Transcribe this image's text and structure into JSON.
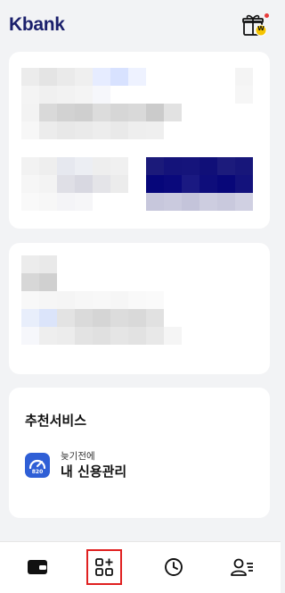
{
  "header": {
    "logo_text": "Kbank",
    "gift_icon": "gift-icon",
    "gift_badge_text": "W"
  },
  "recommend": {
    "title": "추천서비스",
    "item": {
      "icon": "credit-gauge-icon",
      "gauge_value": "820",
      "subtitle": "늦기전에",
      "title": "내 신용관리"
    }
  },
  "bottom_nav": {
    "items": [
      {
        "icon": "wallet-icon",
        "selected": false
      },
      {
        "icon": "services-grid-icon",
        "selected": true
      },
      {
        "icon": "clock-icon",
        "selected": false
      },
      {
        "icon": "user-menu-icon",
        "selected": false
      }
    ]
  },
  "colors": {
    "brand": "#1a1f6b",
    "gauge_bg": "#2f5fd6",
    "highlight_border": "#e02020"
  }
}
